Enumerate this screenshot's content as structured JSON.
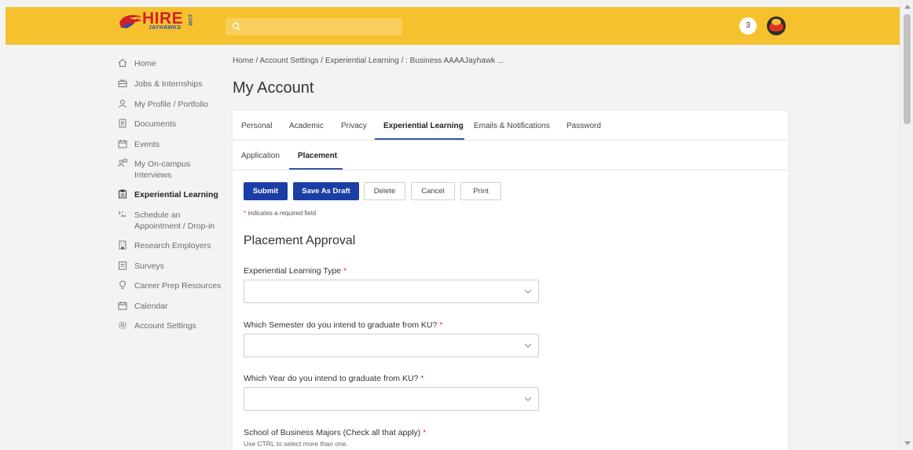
{
  "header": {
    "logo": {
      "main": "HIRE",
      "sub": "JAYHAWKS",
      "suffix": ".COM"
    },
    "notification_count": "3"
  },
  "sidebar": {
    "items": [
      {
        "label": "Home",
        "icon": "home-icon"
      },
      {
        "label": "Jobs & Internships",
        "icon": "briefcase-icon"
      },
      {
        "label": "My Profile / Portfolio",
        "icon": "user-icon"
      },
      {
        "label": "Documents",
        "icon": "document-icon"
      },
      {
        "label": "Events",
        "icon": "calendar-event-icon"
      },
      {
        "label": "My On-campus Interviews",
        "icon": "interview-icon"
      },
      {
        "label": "Experiential Learning",
        "icon": "clipboard-icon",
        "active": true
      },
      {
        "label": "Schedule an Appointment / Drop-in",
        "icon": "appointment-icon"
      },
      {
        "label": "Research Employers",
        "icon": "building-icon"
      },
      {
        "label": "Surveys",
        "icon": "survey-icon"
      },
      {
        "label": "Career Prep Resources",
        "icon": "lightbulb-icon"
      },
      {
        "label": "Calendar",
        "icon": "calendar-icon"
      },
      {
        "label": "Account Settings",
        "icon": "gear-icon"
      }
    ]
  },
  "breadcrumb": "Home / Account Settings / Experiential Learning / : Business AAAAJayhawk ...",
  "page_title": "My Account",
  "tabs": [
    {
      "label": "Personal"
    },
    {
      "label": "Academic"
    },
    {
      "label": "Privacy"
    },
    {
      "label": "Experiential Learning",
      "active": true
    },
    {
      "label": "Emails & Notifications"
    },
    {
      "label": "Password"
    }
  ],
  "subtabs": [
    {
      "label": "Application"
    },
    {
      "label": "Placement",
      "active": true
    }
  ],
  "buttons": {
    "submit": "Submit",
    "save_draft": "Save As Draft",
    "delete": "Delete",
    "cancel": "Cancel",
    "print": "Print"
  },
  "required_note": {
    "star": "*",
    "text": " indicates a required field"
  },
  "section_title": "Placement Approval",
  "fields": [
    {
      "label": "Experiential Learning Type",
      "required": "*",
      "value": ""
    },
    {
      "label": "Which Semester do you intend to graduate from KU?",
      "required": "*",
      "value": ""
    },
    {
      "label": "Which Year do you intend to graduate from KU?",
      "required": "*",
      "value": ""
    },
    {
      "label": "School of Business Majors (Check all that apply)",
      "required": "*",
      "help": "Use CTRL to select more than one."
    }
  ],
  "colors": {
    "header": "#f6c12e",
    "primary_button": "#1b3ea6",
    "tab_underline": "#3457a6",
    "required": "#d43a2f"
  }
}
